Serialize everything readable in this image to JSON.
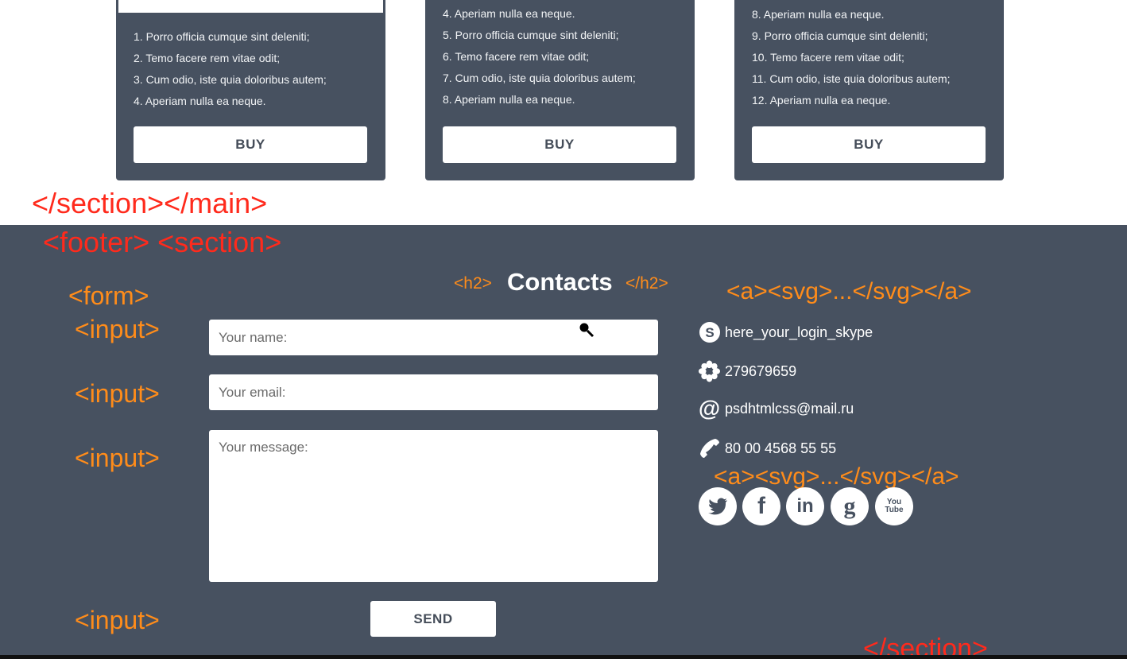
{
  "cards": [
    {
      "items": [
        "1. Porro officia cumque sint deleniti;",
        "2. Temo facere rem vitae odit;",
        "3. Cum odio, iste quia doloribus autem;",
        "4. Aperiam nulla ea neque."
      ],
      "button": "BUY"
    },
    {
      "items": [
        "4. Aperiam nulla ea neque.",
        "5. Porro officia cumque sint deleniti;",
        "6. Temo facere rem vitae odit;",
        "7. Cum odio, iste quia doloribus autem;",
        "8. Aperiam nulla ea neque."
      ],
      "button": "BUY"
    },
    {
      "items": [
        "8. Aperiam nulla ea neque.",
        "9. Porro officia cumque sint deleniti;",
        "10. Temo facere rem vitae odit;",
        "11. Cum odio, iste quia doloribus autem;",
        "12. Aperiam nulla ea neque."
      ],
      "button": "BUY"
    }
  ],
  "annotations": {
    "section_main_close": "</section></main>",
    "footer_section_open": "<footer> <section>",
    "form_open": "<form>",
    "input_1": "<input>",
    "input_2": "<input>",
    "input_3": "<input>",
    "input_4": "<input>",
    "h2_open": "<h2>",
    "h2_close": "</h2>",
    "a_svg_1": "<a><svg>...</svg></a>",
    "a_svg_2": "<a><svg>...</svg></a>",
    "section_close": "</section>"
  },
  "contacts": {
    "title": "Contacts",
    "form": {
      "name_placeholder": "Your name:",
      "email_placeholder": "Your email:",
      "message_placeholder": "Your message:",
      "send_label": "SEND"
    },
    "skype": "here_your_login_skype",
    "icq": "279679659",
    "email": "psdhtmlcss@mail.ru",
    "phone": "80 00 4568 55 55",
    "social": [
      {
        "name": "twitter-icon",
        "label": ""
      },
      {
        "name": "facebook-icon",
        "label": "f"
      },
      {
        "name": "linkedin-icon",
        "label": "in"
      },
      {
        "name": "google-icon",
        "label": "g"
      },
      {
        "name": "youtube-icon",
        "label": "You Tube"
      }
    ]
  },
  "colors": {
    "panel": "#475160",
    "annotation_red": "#ff2a1c",
    "annotation_orange": "#ff8c1a",
    "button_text": "#454d59"
  }
}
